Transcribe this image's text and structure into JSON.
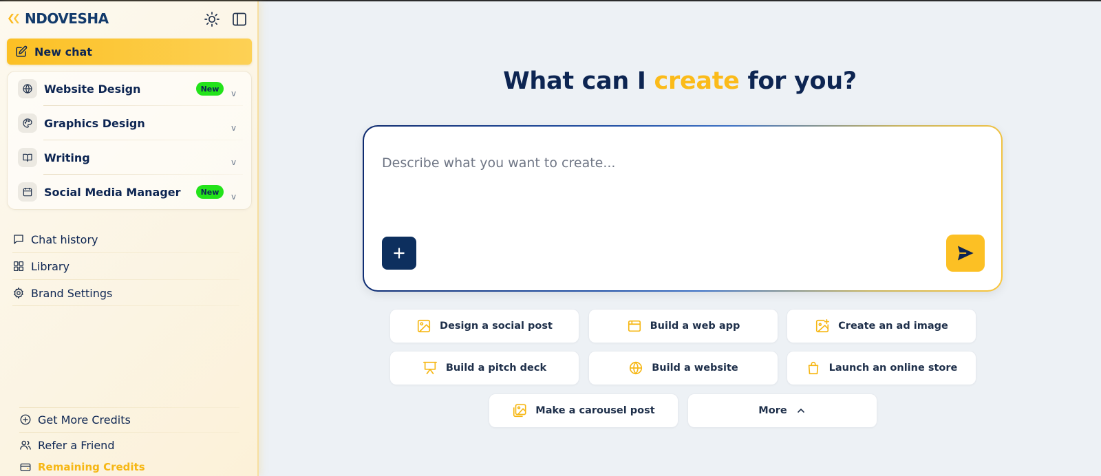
{
  "brand": {
    "name": "NDOVESHA"
  },
  "colors": {
    "accent": "#fcc024",
    "navy": "#0d2552",
    "badge_green": "#23e31a"
  },
  "sidebar": {
    "theme_toggle_icon": "sun-icon",
    "collapse_icon": "sidebar-panel-icon",
    "new_chat": {
      "label": "New chat",
      "icon": "edit-icon"
    },
    "tools": [
      {
        "label": "Website Design",
        "icon": "globe-icon",
        "badge": "New",
        "chevron": "v"
      },
      {
        "label": "Graphics Design",
        "icon": "palette-icon",
        "badge": "",
        "chevron": "v"
      },
      {
        "label": "Writing",
        "icon": "book-icon",
        "badge": "",
        "chevron": "v"
      },
      {
        "label": "Social Media Manager",
        "icon": "calendar-icon",
        "badge": "New",
        "chevron": "v"
      }
    ],
    "nav": [
      {
        "label": "Chat history",
        "icon": "message-icon"
      },
      {
        "label": "Library",
        "icon": "grid-icon"
      },
      {
        "label": "Brand Settings",
        "icon": "gear-icon"
      }
    ],
    "bottom": [
      {
        "label": "Get More Credits",
        "icon": "plus-circle-icon"
      },
      {
        "label": "Refer a Friend",
        "icon": "users-icon"
      }
    ],
    "credits": {
      "label": "Remaining Credits",
      "icon": "credit-card-icon"
    }
  },
  "main": {
    "headline_before": "What can I ",
    "headline_accent": "create",
    "headline_after": " for you?",
    "prompt": {
      "placeholder": "Describe what you want to create...",
      "value": ""
    },
    "attach_icon": "plus-icon",
    "send_icon": "send-icon",
    "suggestions": [
      {
        "label": "Design a social post",
        "icon": "image-icon"
      },
      {
        "label": "Build a web app",
        "icon": "browser-icon"
      },
      {
        "label": "Create an ad image",
        "icon": "image-plus-icon"
      },
      {
        "label": "Build a pitch deck",
        "icon": "presentation-icon"
      },
      {
        "label": "Build a website",
        "icon": "globe-icon"
      },
      {
        "label": "Launch an online store",
        "icon": "shopping-bag-icon"
      },
      {
        "label": "Make a carousel post",
        "icon": "images-icon"
      },
      {
        "label": "More",
        "icon": "chevron-up-icon"
      }
    ]
  }
}
